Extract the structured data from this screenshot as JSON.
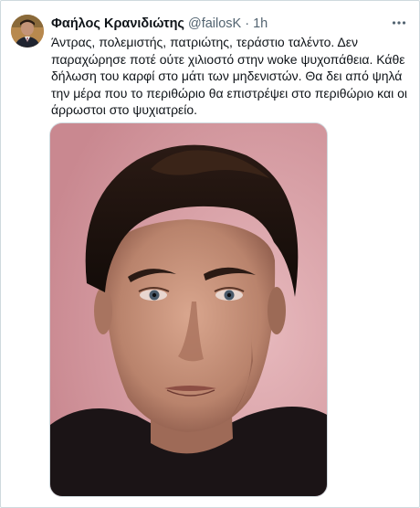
{
  "tweet": {
    "author_name": "Φαήλος Κρανιδιώτης",
    "handle": "@failosK",
    "separator": "·",
    "time": "1h",
    "more_icon": "more-horizontal-icon",
    "text_lines": [
      "Άντρας, πολεμιστής, πατριώτης, τεράστιο ταλέντο. Δεν",
      "παραχώρησε ποτέ ούτε χιλιοστό στην woke ψυχοπάθεια. Κάθε",
      "δήλωση του καρφί στο μάτι των μηδενιστών. Θα δει από ψηλά",
      "την μέρα που το περιθώριο θα επιστρέψει στο περιθώριο και οι",
      "άρρωστοι στο ψυχιατρείο."
    ]
  },
  "colors": {
    "text": "#0f1419",
    "secondary": "#536471",
    "border": "#cfd9de",
    "photo_background": "#d9a0a8"
  }
}
